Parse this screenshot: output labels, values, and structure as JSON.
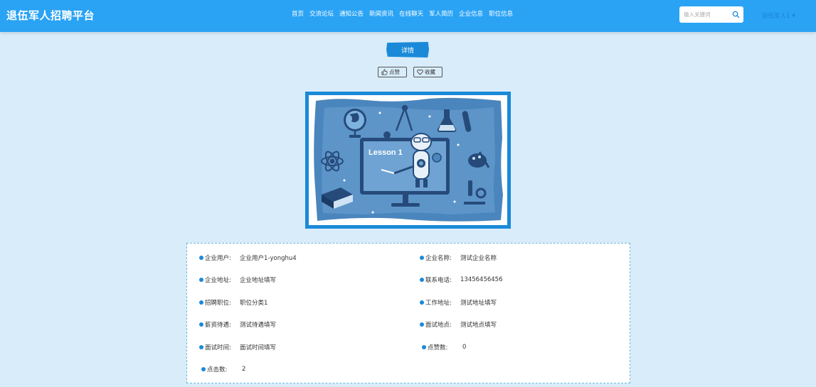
{
  "header": {
    "site_title": "退伍军人招聘平台",
    "nav": [
      "首页",
      "交流论坛",
      "通知公告",
      "新闻资讯",
      "在线聊天",
      "军人简历",
      "企业信息",
      "职位信息"
    ],
    "search": {
      "placeholder": "输入关键词",
      "value": ""
    },
    "user": {
      "name": "退伍军人1"
    }
  },
  "detail": {
    "title": "详情",
    "like_label": "点赞",
    "collect_label": "收藏"
  },
  "image": {
    "board_text": "Lesson 1"
  },
  "info": {
    "left": [
      {
        "label": "企业用户:",
        "value": "企业用户1-yonghu4"
      },
      {
        "label": "企业地址:",
        "value": "企业地址填写"
      },
      {
        "label": "招聘职位:",
        "value": "职位分类1"
      },
      {
        "label": "薪资待遇:",
        "value": "测试待遇填写"
      },
      {
        "label": "面试时间:",
        "value": "面试时间填写"
      },
      {
        "label": "点击数:",
        "value": "2"
      }
    ],
    "right": [
      {
        "label": "企业名称:",
        "value": "测试企业名称"
      },
      {
        "label": "联系电话:",
        "value": "13456456456"
      },
      {
        "label": "工作地址:",
        "value": "测试地址填写"
      },
      {
        "label": "面试地点:",
        "value": "测试地点填写"
      },
      {
        "label": "点赞数:",
        "value": "0"
      }
    ]
  },
  "colors": {
    "header_bg": "#2aa3f5",
    "accent": "#1a8ad8",
    "page_bg": "#d9ecfa"
  }
}
